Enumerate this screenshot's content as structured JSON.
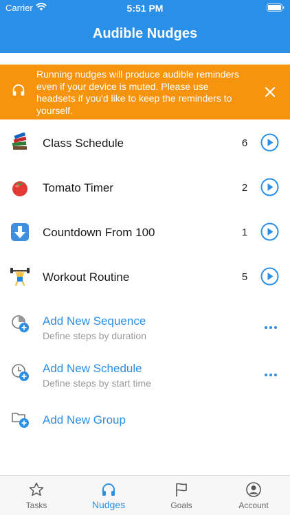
{
  "status_bar": {
    "carrier": "Carrier",
    "time": "5:51 PM"
  },
  "header": {
    "title": "Audible Nudges"
  },
  "banner": {
    "text": "Running nudges will produce audible reminders even if your device is muted. Please use headsets if you'd like to keep the reminders to yourself.",
    "icon": "headphones-icon",
    "close_icon": "close-icon"
  },
  "nudges": [
    {
      "icon": "books-icon",
      "label": "Class Schedule",
      "count": "6"
    },
    {
      "icon": "tomato-icon",
      "label": "Tomato Timer",
      "count": "2"
    },
    {
      "icon": "down-arrow-icon",
      "label": "Countdown From 100",
      "count": "1"
    },
    {
      "icon": "weightlifter-icon",
      "label": "Workout Routine",
      "count": "5"
    }
  ],
  "add_actions": [
    {
      "title": "Add New Sequence",
      "subtitle": "Define steps by duration"
    },
    {
      "title": "Add New Schedule",
      "subtitle": "Define steps by start time"
    },
    {
      "title": "Add New Group"
    }
  ],
  "tabs": [
    {
      "label": "Tasks",
      "icon": "star-icon"
    },
    {
      "label": "Nudges",
      "icon": "headphones-icon",
      "active": true
    },
    {
      "label": "Goals",
      "icon": "flag-icon"
    },
    {
      "label": "Account",
      "icon": "person-circle-icon"
    }
  ],
  "colors": {
    "accent": "#2a8fe6",
    "banner": "#f7940e",
    "tab_bar": "#f7f7f7"
  }
}
